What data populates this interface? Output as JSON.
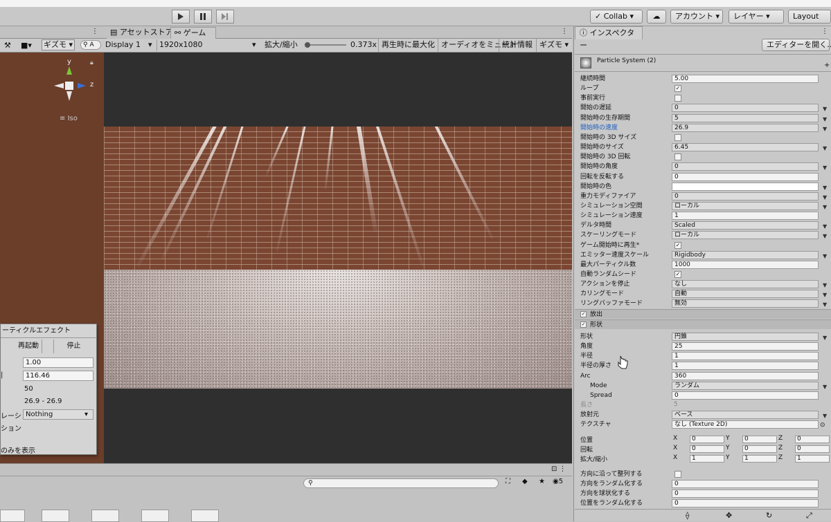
{
  "toolbar": {
    "collab": "Collab",
    "account": "アカウント",
    "layers": "レイヤー",
    "layout": "Layout"
  },
  "scene": {
    "gizmo_label": "ギズモ",
    "search_prefix": "A",
    "axis_y": "y",
    "axis_z": "z",
    "iso": "Iso"
  },
  "game": {
    "tab_asset_store": "アセットストア",
    "tab_game": "ゲーム",
    "display": "Display 1",
    "resolution": "1920x1080",
    "scale_label": "拡大/縮小",
    "scale_value": "0.373x",
    "maximize_on_play": "再生時に最大化",
    "mute_audio": "オーディオをミュート",
    "stats": "統計情報",
    "gizmos": "ギズモ"
  },
  "popup": {
    "title": "ーティクルエフェクト",
    "restart": "再起動",
    "stop": "停止",
    "playback_speed": "1.00",
    "playback_time": "116.46",
    "particles": "50",
    "speed_range": "26.9 - 26.9",
    "simulate_label": "レーション",
    "simulate_value": "Nothing",
    "show_only_label": "ション",
    "show_selected": "のみを表示"
  },
  "bottom": {
    "layer_count": "5"
  },
  "inspector": {
    "tab": "インスペクター",
    "open_editor": "エディターを開く...",
    "component": "Particle System (2)",
    "main_rows": [
      {
        "label": "継続時間",
        "value": "5.00",
        "kind": "field"
      },
      {
        "label": "ループ",
        "value": "✓",
        "kind": "check"
      },
      {
        "label": "事前実行",
        "value": "",
        "kind": "check"
      },
      {
        "label": "開始の遅延",
        "value": "0",
        "kind": "dd"
      },
      {
        "label": "開始時の生存期間",
        "value": "5",
        "kind": "dd"
      },
      {
        "label": "開始時の速度",
        "value": "26.9",
        "kind": "dd",
        "highlight": true
      },
      {
        "label": "開始時の 3D サイズ",
        "value": "",
        "kind": "check"
      },
      {
        "label": "開始時のサイズ",
        "value": "6.45",
        "kind": "dd"
      },
      {
        "label": "開始時の 3D 回転",
        "value": "",
        "kind": "check"
      },
      {
        "label": "開始時の角度",
        "value": "0",
        "kind": "dd"
      },
      {
        "label": "回転を反転する",
        "value": "0",
        "kind": "field"
      },
      {
        "label": "開始時の色",
        "value": "",
        "kind": "color"
      },
      {
        "label": "重力モディファイア",
        "value": "0",
        "kind": "dd"
      },
      {
        "label": "シミュレーション空間",
        "value": "ローカル",
        "kind": "dd"
      },
      {
        "label": "シミュレーション速度",
        "value": "1",
        "kind": "field"
      },
      {
        "label": "デルタ時間",
        "value": "Scaled",
        "kind": "dd"
      },
      {
        "label": "スケーリングモード",
        "value": "ローカル",
        "kind": "dd"
      },
      {
        "label": "ゲーム開始時に再生*",
        "value": "✓",
        "kind": "check"
      },
      {
        "label": "エミッター速度スケール",
        "value": "Rigidbody",
        "kind": "dd"
      },
      {
        "label": "最大パーティクル数",
        "value": "1000",
        "kind": "field"
      },
      {
        "label": "自動ランダムシード",
        "value": "✓",
        "kind": "check"
      },
      {
        "label": "アクションを停止",
        "value": "なし",
        "kind": "dd"
      },
      {
        "label": "カリングモード",
        "value": "自動",
        "kind": "dd"
      },
      {
        "label": "リングバッファモード",
        "value": "無効",
        "kind": "dd"
      }
    ],
    "section_emission": "放出",
    "section_shape": "形状",
    "shape_rows": [
      {
        "label": "形状",
        "value": "円錐",
        "kind": "dd"
      },
      {
        "label": "角度",
        "value": "25",
        "kind": "field"
      },
      {
        "label": "半径",
        "value": "1",
        "kind": "field"
      },
      {
        "label": "半径の厚さ",
        "value": "1",
        "kind": "field"
      },
      {
        "label": "Arc",
        "value": "360",
        "kind": "field"
      },
      {
        "label": "Mode",
        "value": "ランダム",
        "kind": "dd",
        "indent": true
      },
      {
        "label": "Spread",
        "value": "0",
        "kind": "field",
        "indent": true
      },
      {
        "label": "長さ",
        "value": "5",
        "kind": "disabled"
      },
      {
        "label": "放射元",
        "value": "ベース",
        "kind": "dd"
      },
      {
        "label": "テクスチャ",
        "value": "なし (Texture 2D)",
        "kind": "field"
      }
    ],
    "transform": [
      {
        "label": "位置",
        "x": "0",
        "y": "0",
        "z": "0"
      },
      {
        "label": "回転",
        "x": "0",
        "y": "0",
        "z": "0"
      },
      {
        "label": "拡大/縮小",
        "x": "1",
        "y": "1",
        "z": "1"
      }
    ],
    "axis": {
      "x": "X",
      "y": "Y",
      "z": "Z"
    },
    "bottom_rows": [
      {
        "label": "方向に沿って整列する",
        "value": "",
        "kind": "check"
      },
      {
        "label": "方向をランダム化する",
        "value": "0",
        "kind": "field"
      },
      {
        "label": "方向を球状化する",
        "value": "0",
        "kind": "field"
      },
      {
        "label": "位置をランダム化する",
        "value": "0",
        "kind": "field"
      }
    ]
  }
}
